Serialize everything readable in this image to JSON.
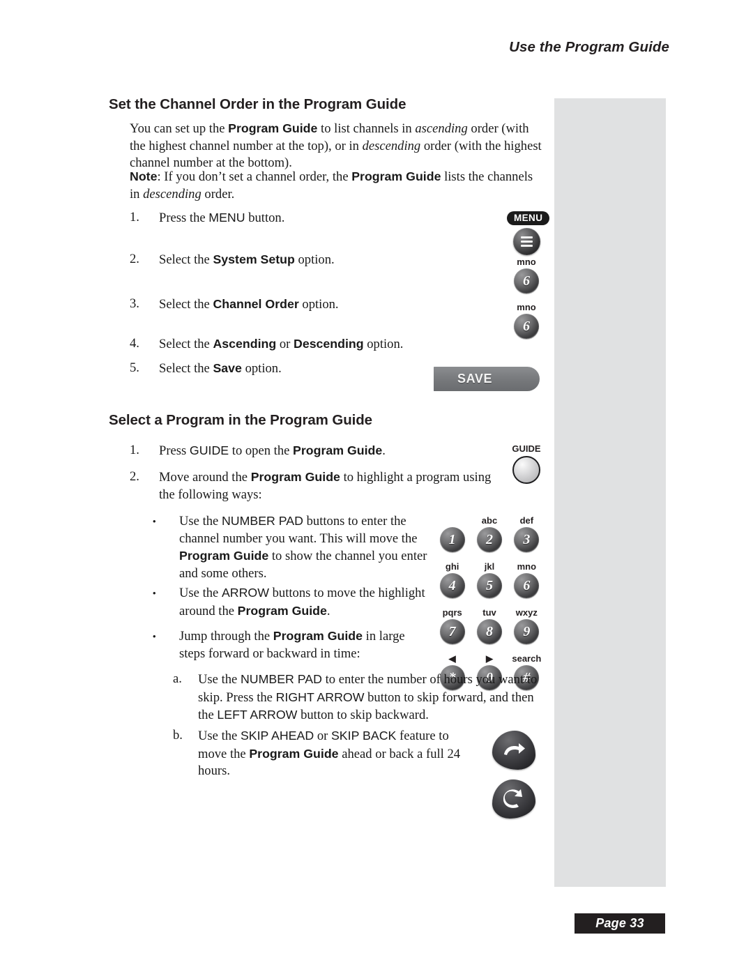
{
  "header": {
    "running_head": "Use the Program Guide"
  },
  "footer": {
    "page_label": "Page 33"
  },
  "sections": [
    {
      "heading": "Set the Channel Order in the Program Guide",
      "intro_paragraph": "You can set up the Program Guide to list channels in ascending order (with the highest channel number at the top), or in descending order (with the highest channel number at the bottom).",
      "note_paragraph": "Note: If you don't set a channel order, the Program Guide lists the channels in descending order.",
      "steps": [
        {
          "marker": "1.",
          "text": "Press the MENU button."
        },
        {
          "marker": "2.",
          "text": "Select the System Setup option."
        },
        {
          "marker": "3.",
          "text": "Select the Channel Order option."
        },
        {
          "marker": "4.",
          "text": "Select the Ascending or Descending option."
        },
        {
          "marker": "5.",
          "text": "Select the Save option."
        }
      ]
    },
    {
      "heading": "Select a Program in the Program Guide",
      "steps": [
        {
          "marker": "1.",
          "text": "Press GUIDE to open the Program Guide."
        },
        {
          "marker": "2.",
          "text": "Move around the Program Guide to highlight a program using the following ways:"
        }
      ],
      "bullets": [
        {
          "marker": "•",
          "text": "Use the NUMBER PAD buttons to enter the channel number you want. This will move the Program Guide to show the channel you enter and some others."
        },
        {
          "marker": "•",
          "text": "Use the ARROW buttons to move the highlight around the Program Guide."
        },
        {
          "marker": "•",
          "text": "Jump through the Program Guide in large steps forward or backward in time:"
        }
      ],
      "sub_steps": [
        {
          "marker": "a.",
          "text": "Use the NUMBER PAD to enter the number of hours you want to skip. Press the RIGHT ARROW button to skip forward, and then the LEFT ARROW button to skip backward."
        },
        {
          "marker": "b.",
          "text": "Use the SKIP AHEAD or SKIP BACK feature to move the Program Guide ahead or back a full 24 hours."
        }
      ]
    }
  ],
  "remote": {
    "menu_label": "MENU",
    "menu_icon": "hamburger-icon",
    "six_key_letters": "mno",
    "six_key_digit": "6",
    "save_label": "SAVE",
    "guide_label": "GUIDE",
    "keypad": [
      {
        "letters": "",
        "digit": "1"
      },
      {
        "letters": "abc",
        "digit": "2"
      },
      {
        "letters": "def",
        "digit": "3"
      },
      {
        "letters": "ghi",
        "digit": "4"
      },
      {
        "letters": "jkl",
        "digit": "5"
      },
      {
        "letters": "mno",
        "digit": "6"
      },
      {
        "letters": "pqrs",
        "digit": "7"
      },
      {
        "letters": "tuv",
        "digit": "8"
      },
      {
        "letters": "wxyz",
        "digit": "9"
      },
      {
        "letters": "◀",
        "digit": "*"
      },
      {
        "letters": "▶",
        "digit": "0"
      },
      {
        "letters": "search",
        "digit": "#"
      }
    ],
    "skip_ahead_icon": "skip-ahead-arrow-icon",
    "skip_back_icon": "skip-back-arrow-icon"
  },
  "colors": {
    "side_panel": "#e0e1e2",
    "ink": "#231f20",
    "page_number_bg": "#231f20"
  }
}
